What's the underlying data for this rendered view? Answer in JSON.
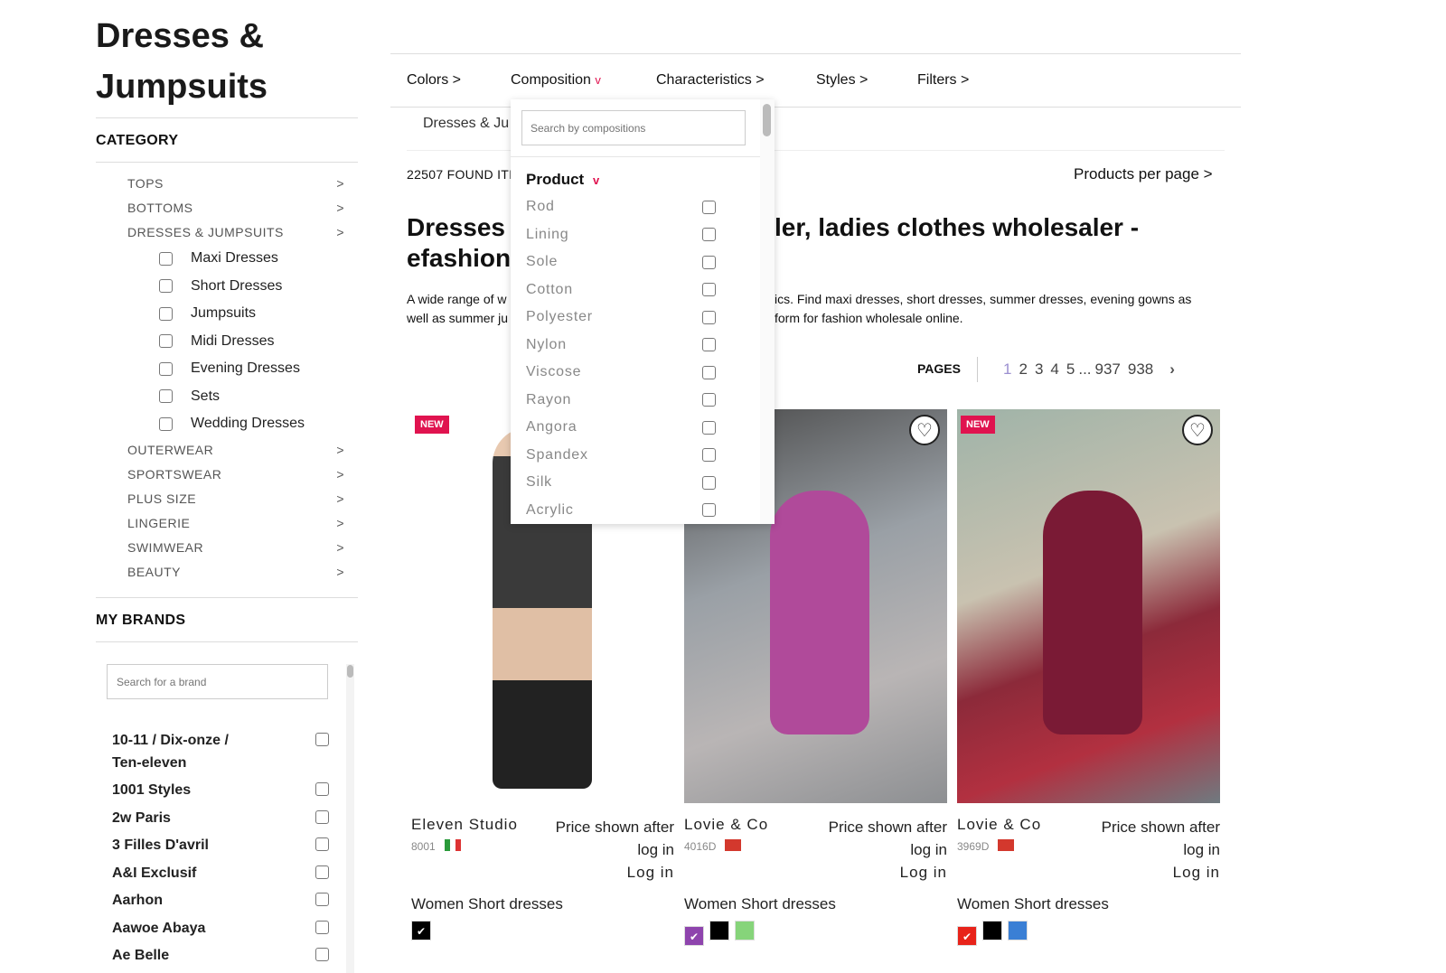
{
  "page_title": "Dresses & Jumpsuits",
  "category": {
    "heading": "CATEGORY",
    "items": [
      {
        "label": "TOPS"
      },
      {
        "label": "BOTTOMS"
      },
      {
        "label": "DRESSES & JUMPSUITS"
      }
    ],
    "subitems": [
      "Maxi Dresses",
      "Short Dresses",
      "Jumpsuits",
      "Midi Dresses",
      "Evening Dresses",
      "Sets",
      "Wedding Dresses"
    ],
    "more": [
      "OUTERWEAR",
      "SPORTSWEAR",
      "PLUS SIZE",
      "LINGERIE",
      "SWIMWEAR",
      "BEAUTY"
    ],
    "arrow": ">"
  },
  "brands": {
    "heading": "MY BRANDS",
    "search_placeholder": "Search for a brand",
    "items": [
      "10-11 / Dix-onze / Ten-eleven",
      "1001 Styles",
      "2w Paris",
      "3 Filles D'avril",
      "A&I Exclusif",
      "Aarhon",
      "Aawoe Abaya",
      "Ae Belle"
    ]
  },
  "nav": [
    "Colors >",
    "Composition",
    "Characteristics >",
    "Styles >",
    "Filters >"
  ],
  "nav_active_chevron": "v",
  "breadcrumb": "Dresses & Ju",
  "found": "22507 FOUND ITI",
  "per_page": "Products per page >",
  "heading_left1": "Dresses",
  "heading_right": "ler, ladies clothes wholesaler -",
  "heading_left2": "efashion",
  "desc_left1": "A wide range of w",
  "desc_left2": "well as summer ju",
  "desc_right1": "ics. Find maxi dresses, short dresses, summer dresses, evening gowns as",
  "desc_right2": "form for fashion wholesale online.",
  "pages": {
    "label": "PAGES",
    "items": [
      "1",
      "2",
      "3",
      "4",
      "5",
      "...",
      "937",
      "938"
    ],
    "current": "1",
    "next": "›"
  },
  "dropdown": {
    "search_placeholder": "Search by compositions",
    "group": "Product",
    "group_chevron": "v",
    "items": [
      "Rod",
      "Lining",
      "Sole",
      "Cotton",
      "Polyester",
      "Nylon",
      "Viscose",
      "Rayon",
      "Angora",
      "Spandex",
      "Silk",
      "Acrylic"
    ]
  },
  "products": [
    {
      "badge": "NEW",
      "brand": "Eleven Studio",
      "ref": "8001",
      "flag": "italy",
      "price": "Price shown after log in",
      "login": "Log in",
      "category": "Women Short dresses",
      "swatches": [
        "#000000"
      ],
      "favorite": false
    },
    {
      "badge": "",
      "brand": "Lovie & Co",
      "ref": "4016D",
      "flag": "china",
      "price": "Price shown after log in",
      "login": "Log in",
      "category": "Women Short dresses",
      "swatches": [
        "#8e44ad",
        "#000000",
        "#86d47a"
      ],
      "favorite": true
    },
    {
      "badge": "NEW",
      "brand": "Lovie & Co",
      "ref": "3969D",
      "flag": "china",
      "price": "Price shown after log in",
      "login": "Log in",
      "category": "Women Short dresses",
      "swatches": [
        "#e8231a",
        "#000000",
        "#3a7fd5"
      ],
      "favorite": true
    }
  ],
  "colors": {
    "accent": "#e0134f",
    "page_current": "#9b8fd0"
  }
}
